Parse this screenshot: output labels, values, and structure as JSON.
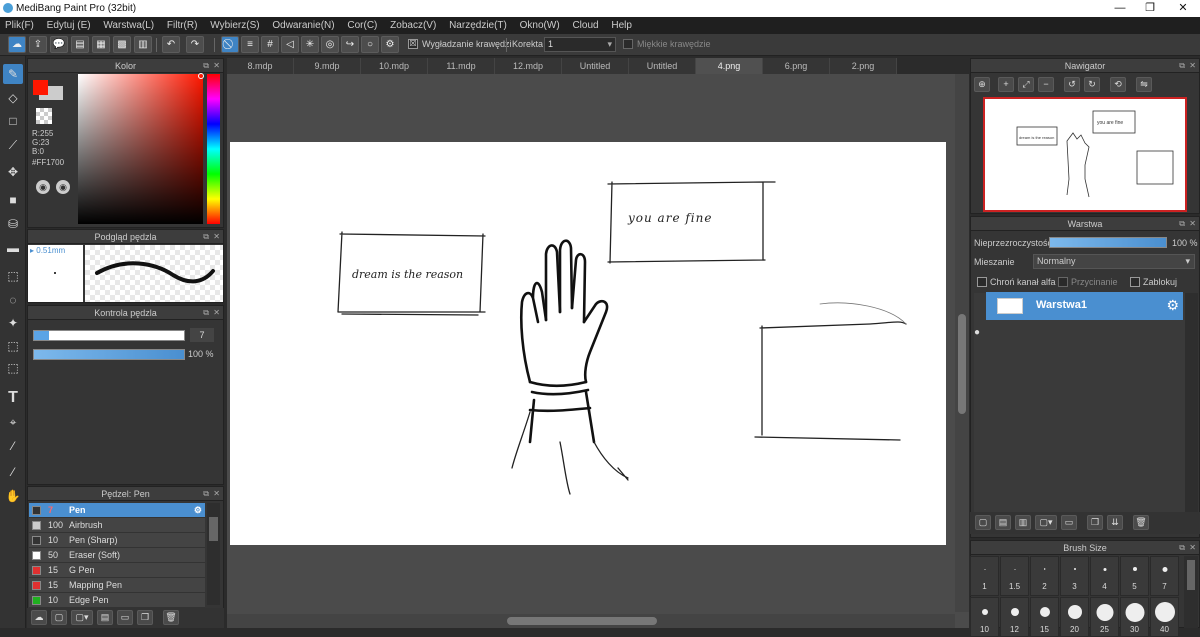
{
  "window": {
    "title": "MediBang Paint Pro (32bit)"
  },
  "menu": [
    "Plik(F)",
    "Edytuj (E)",
    "Warstwa(L)",
    "Filtr(R)",
    "Wybierz(S)",
    "Odwaranie(N)",
    "Cor(C)",
    "Zobacz(V)",
    "Narzędzie(T)",
    "Okno(W)",
    "Cloud",
    "Help"
  ],
  "toolbar": {
    "smoothing_label": "Wygładzanie krawędzi",
    "smoothing_checked": "☒",
    "correction_label": "Korekta",
    "correction_value": "1",
    "soft_edges_label": "Miękkie krawędzie"
  },
  "color_panel": {
    "title": "Kolor",
    "r": "R:255",
    "g": "G:23",
    "b": "B:0",
    "hex": "#FF1700",
    "fg_color": "#ff1700"
  },
  "brush_preview": {
    "title": "Podgląd pędzla",
    "size": "0.51mm"
  },
  "brush_control": {
    "title": "Kontrola pędzla",
    "size_value": "7",
    "opacity_value": "100 %",
    "size_fraction": 0.1,
    "opacity_fraction": 1.0
  },
  "brush_list": {
    "title": "Pędzel: Pen",
    "items": [
      {
        "size": "7",
        "name": "Pen",
        "color": "#333333"
      },
      {
        "size": "100",
        "name": "Airbrush",
        "color": "#cccccc"
      },
      {
        "size": "10",
        "name": "Pen (Sharp)",
        "color": "#333333"
      },
      {
        "size": "50",
        "name": "Eraser (Soft)",
        "color": "#ffffff"
      },
      {
        "size": "15",
        "name": "G Pen",
        "color": "#e03030"
      },
      {
        "size": "15",
        "name": "Mapping Pen",
        "color": "#e03030"
      },
      {
        "size": "10",
        "name": "Edge Pen",
        "color": "#20b020"
      }
    ]
  },
  "tabs": [
    "8.mdp",
    "9.mdp",
    "10.mdp",
    "11.mdp",
    "12.mdp",
    "Untitled",
    "Untitled",
    "4.png",
    "6.png",
    "2.png"
  ],
  "canvas_text": {
    "box1": "dream is the reason",
    "box2": "you are fine"
  },
  "navigator": {
    "title": "Nawigator",
    "mini1": "dream is the reason",
    "mini2": "you are fine"
  },
  "layers": {
    "title": "Warstwa",
    "opacity_label": "Nieprzezroczystość",
    "opacity_value": "100 %",
    "opacity_fraction": 1.0,
    "blend_label": "Mieszanie",
    "blend_value": "Normalny",
    "protect_alpha": "Chroń kanał alfa",
    "clipping": "Przycinanie",
    "lock": "Zablokuj",
    "layer_name": "Warstwa1"
  },
  "brush_size": {
    "title": "Brush Size",
    "row1": [
      "1",
      "1.5",
      "2",
      "3",
      "4",
      "5",
      "7"
    ],
    "row2": [
      "10",
      "12",
      "15",
      "20",
      "25",
      "30",
      "40"
    ]
  },
  "window_controls": [
    "—",
    "❐",
    "✕"
  ]
}
